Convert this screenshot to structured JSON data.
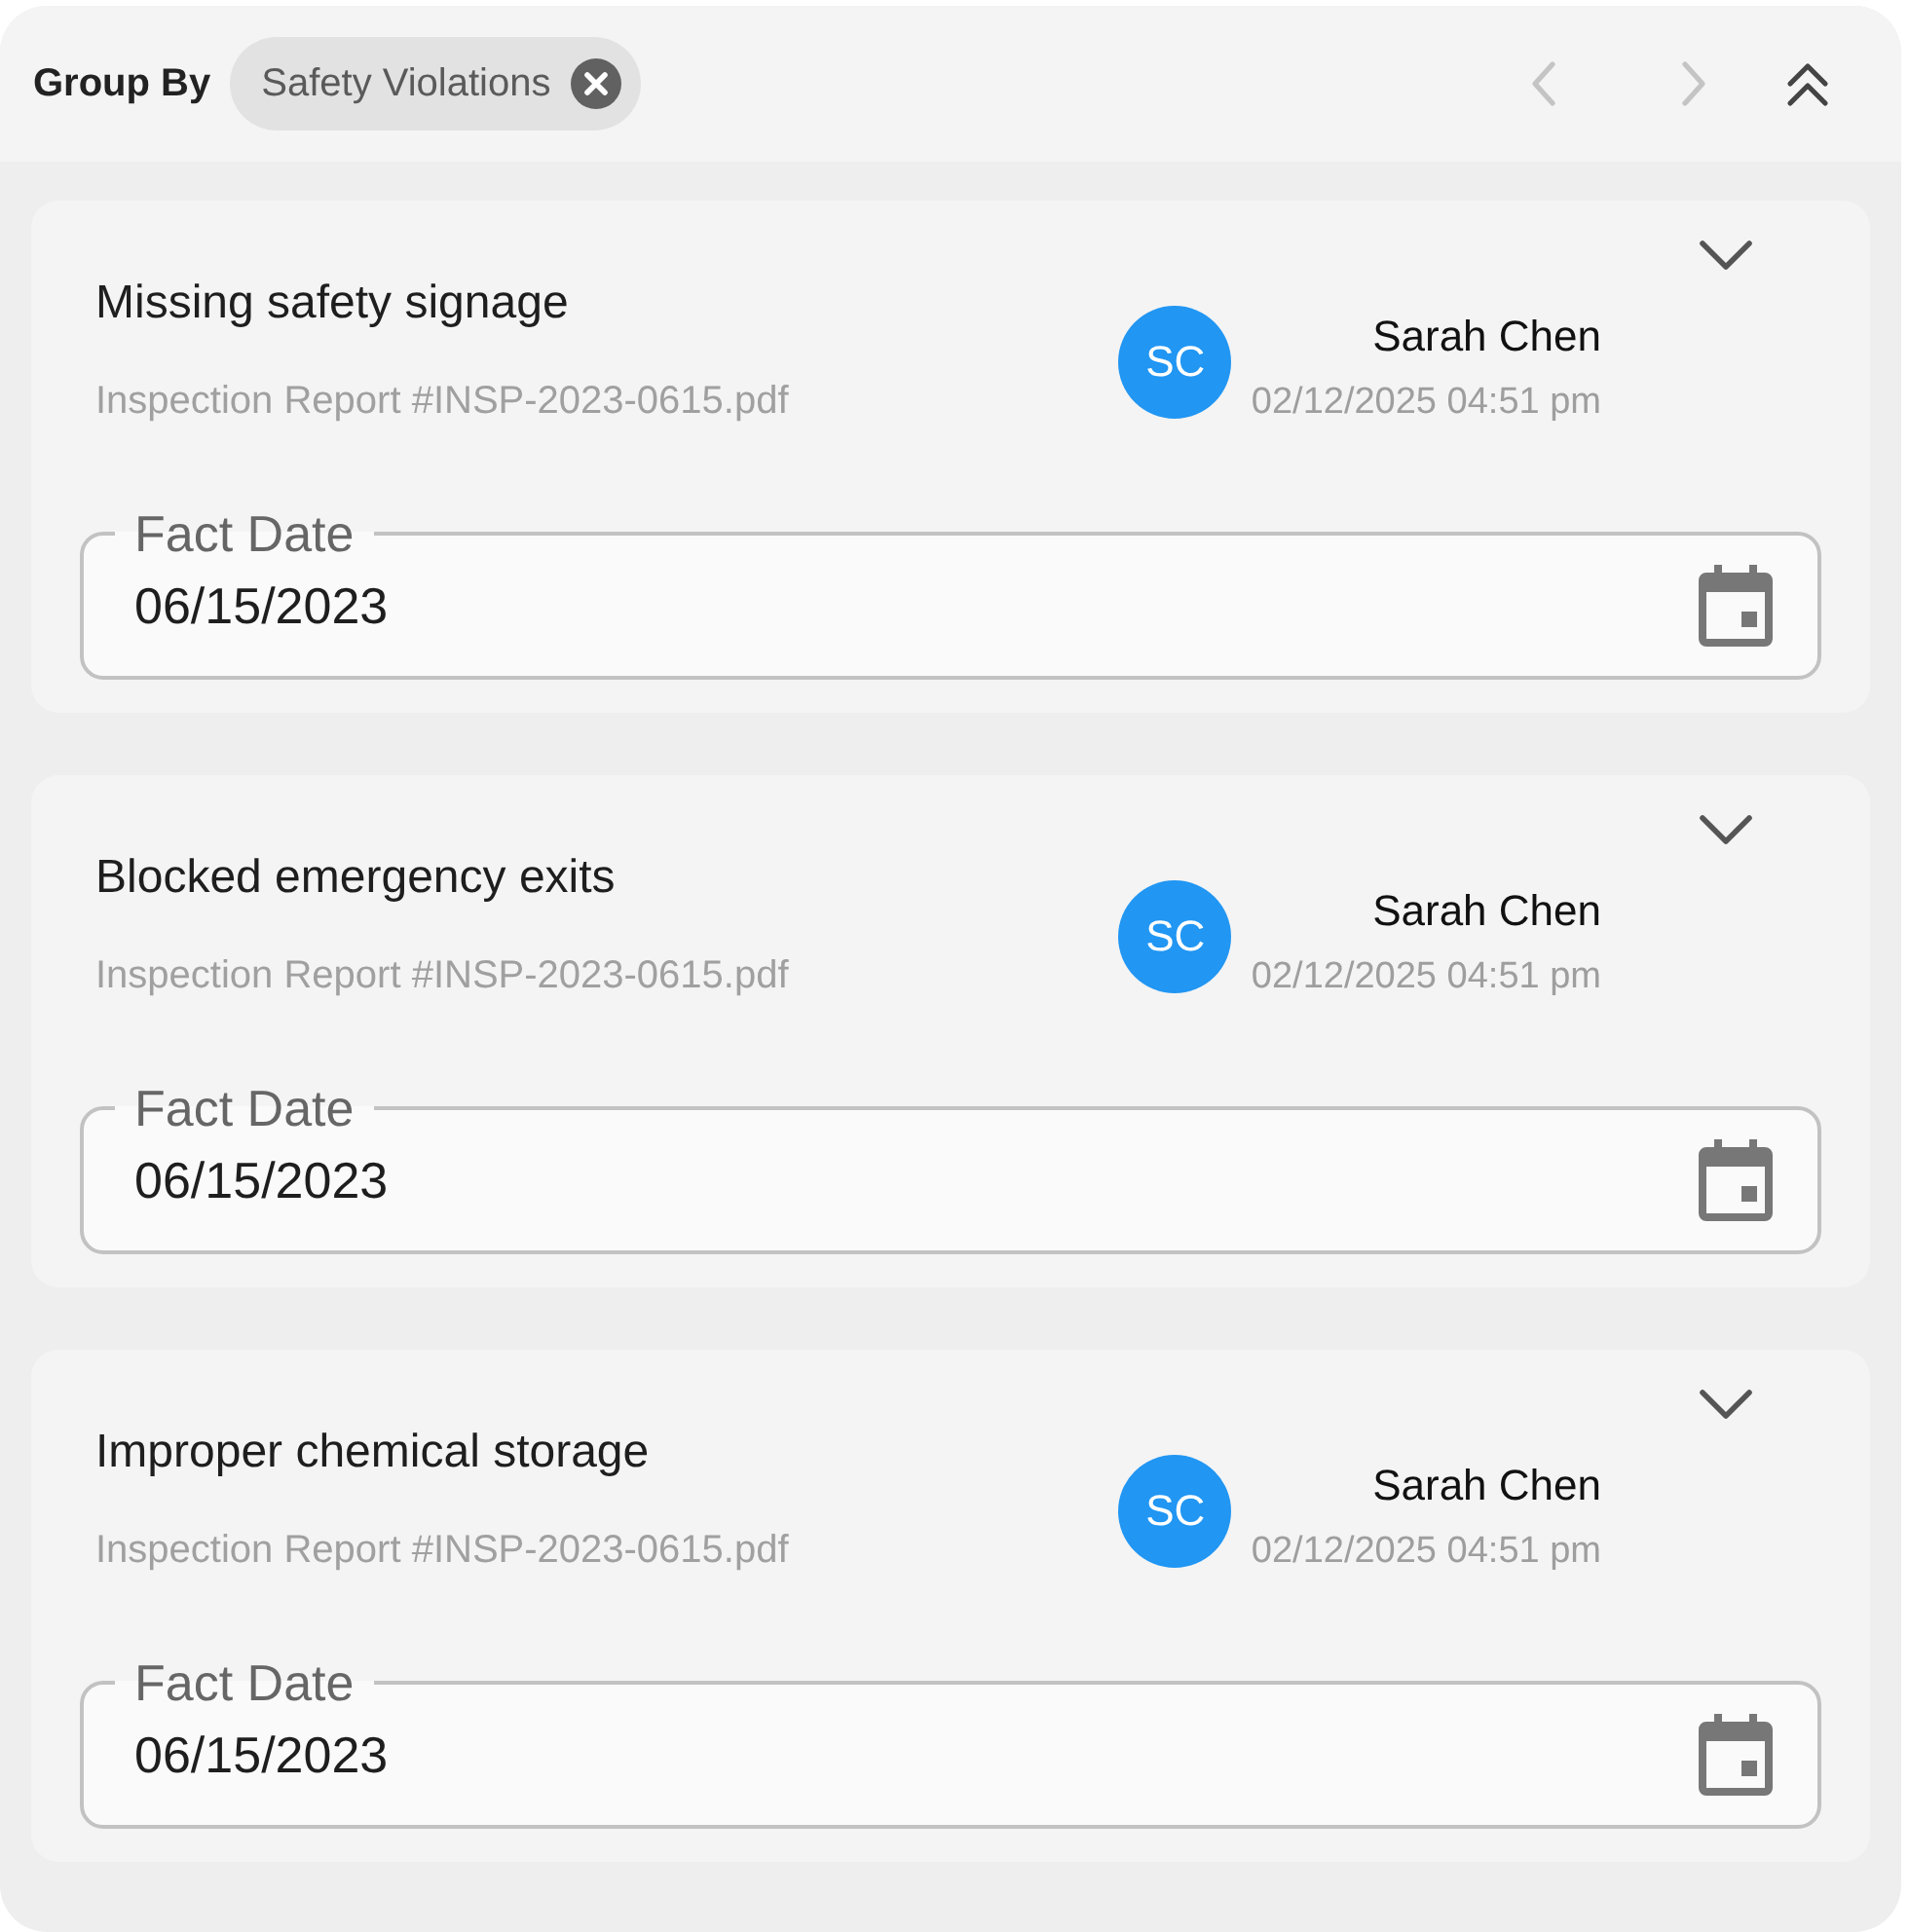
{
  "toolbar": {
    "group_by_label": "Group By",
    "chip": {
      "label": "Safety Violations"
    },
    "prev_button": {
      "disabled": true
    },
    "next_button": {
      "disabled": true
    }
  },
  "cards": [
    {
      "title": "Missing safety signage",
      "source": "Inspection Report #INSP-2023-0615.pdf",
      "author": {
        "initials": "SC",
        "name": "Sarah Chen",
        "timestamp": "02/12/2025 04:51 pm"
      },
      "field": {
        "label": "Fact Date",
        "value": "06/15/2023"
      }
    },
    {
      "title": "Blocked emergency exits",
      "source": "Inspection Report #INSP-2023-0615.pdf",
      "author": {
        "initials": "SC",
        "name": "Sarah Chen",
        "timestamp": "02/12/2025 04:51 pm"
      },
      "field": {
        "label": "Fact Date",
        "value": "06/15/2023"
      }
    },
    {
      "title": "Improper chemical storage",
      "source": "Inspection Report #INSP-2023-0615.pdf",
      "author": {
        "initials": "SC",
        "name": "Sarah Chen",
        "timestamp": "02/12/2025 04:51 pm"
      },
      "field": {
        "label": "Fact Date",
        "value": "06/15/2023"
      }
    }
  ]
}
